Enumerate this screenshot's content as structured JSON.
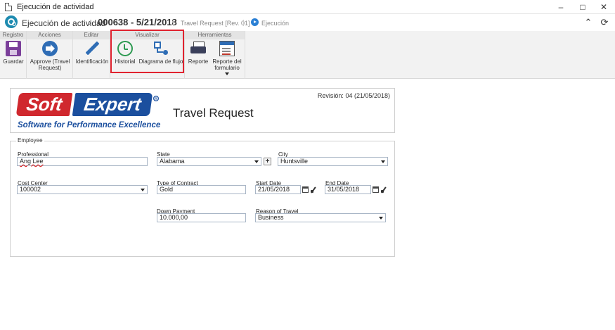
{
  "window": {
    "title": "Ejecución de actividad",
    "minimize": "–",
    "maximize": "□",
    "close": "✕"
  },
  "header": {
    "title": "Ejecución de actividad",
    "separator": "›",
    "record": "000638 - 5/21/2018",
    "process": "Travel Request [Rev. 01]",
    "status": "Ejecución",
    "collapse_icon": "⌃",
    "refresh_icon": "⟳"
  },
  "ribbon": {
    "groups": {
      "registro": "Registro",
      "acciones": "Acciones",
      "editar": "Editar",
      "visualizar": "Visualizar",
      "herramientas": "Herramientas"
    },
    "buttons": {
      "guardar": "Guardar",
      "approve_line1": "Approve (Travel",
      "approve_line2": "Request)",
      "identificacion": "Identificación",
      "historial": "Historial",
      "diagrama": "Diagrama de flujo",
      "reporte": "Reporte",
      "reporte_form_line1": "Reporte del",
      "reporte_form_line2": "formulario"
    }
  },
  "form": {
    "logo_soft": "Soft",
    "logo_expert": "Expert",
    "logo_tagline": "Software for Performance Excellence",
    "title": "Travel Request",
    "revision": "Revisión: 04 (21/05/2018)",
    "section": "Employee",
    "fields": {
      "professional": {
        "label": "Professional",
        "value": "Ang Lee"
      },
      "state": {
        "label": "State",
        "value": "Alabama"
      },
      "city": {
        "label": "City",
        "value": "Huntsville"
      },
      "cost_center": {
        "label": "Cost Center",
        "value": "100002"
      },
      "type_of_contract": {
        "label": "Type of Contract",
        "value": "Gold"
      },
      "start_date": {
        "label": "Start Date",
        "value": "21/05/2018"
      },
      "end_date": {
        "label": "End Date",
        "value": "31/05/2018"
      },
      "down_payment": {
        "label": "Down Payment",
        "value": "10.000,00"
      },
      "reason_of_travel": {
        "label": "Reason of Travel",
        "value": "Business"
      }
    }
  },
  "colors": {
    "highlight": "#e0232f",
    "accent": "#1e8bb0",
    "logo_red": "#d0282e",
    "logo_blue": "#1b4f9e"
  }
}
